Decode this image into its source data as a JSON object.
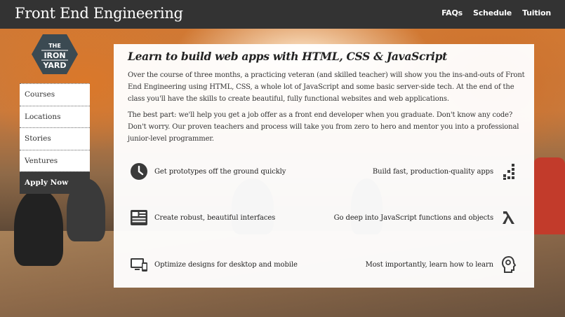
{
  "header": {
    "title": "Front End Engineering",
    "nav": [
      "FAQs",
      "Schedule",
      "Tuition"
    ]
  },
  "logo": {
    "lines": [
      "THE",
      "IRON",
      "YARD"
    ]
  },
  "sidebar": {
    "items": [
      {
        "label": "Courses"
      },
      {
        "label": "Locations"
      },
      {
        "label": "Stories"
      },
      {
        "label": "Ventures"
      },
      {
        "label": "Apply Now"
      }
    ]
  },
  "main": {
    "heading": "Learn to build web apps with HTML, CSS & JavaScript",
    "para1": "Over the course of three months, a practicing veteran (and skilled teacher) will show you the ins-and-outs of Front End Engineering using HTML, CSS, a whole lot of JavaScript and some basic server-side tech.  At the end of the class you'll have the skills to create beautiful, fully functional websites and web applications.",
    "para2": "The best part: we'll help you get a job offer as a front end developer when you graduate. Don't know any code? Don't worry. Our proven teachers and process will take you from zero to hero and mentor you into a professional junior-level programmer.",
    "features": [
      {
        "label": "Get prototypes off the ground quickly",
        "icon": "clock-icon"
      },
      {
        "label": "Build fast, production-quality apps",
        "icon": "pixel-grid-icon"
      },
      {
        "label": "Create robust,  beautiful interfaces",
        "icon": "layout-icon"
      },
      {
        "label": "Go deep into JavaScript functions and objects",
        "icon": "lambda-icon"
      },
      {
        "label": "Optimize designs for desktop and mobile",
        "icon": "devices-icon"
      },
      {
        "label": "Most importantly,  learn how to learn",
        "icon": "head-icon"
      }
    ]
  },
  "colors": {
    "header_bg": "#333333",
    "panel_bg": "#ffffff",
    "active_item_bg": "#3a3a3a",
    "logo_bg": "#3b4a52",
    "icon_color": "#3a3a3a"
  }
}
